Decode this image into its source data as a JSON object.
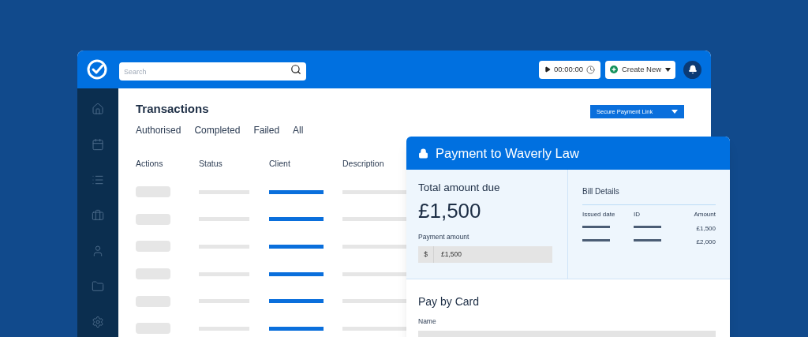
{
  "header": {
    "search": {
      "placeholder": "Search"
    },
    "timer": "00:00:00",
    "create_button": "Create New"
  },
  "transactions": {
    "title": "Transactions",
    "secure_link_button": "Secure Payment Link",
    "tabs": [
      "Authorised",
      "Completed",
      "Failed",
      "All"
    ],
    "columns": [
      "Actions",
      "Status",
      "Client",
      "Description"
    ],
    "rows": [
      {
        "kind": "placeholder"
      },
      {
        "kind": "placeholder"
      },
      {
        "kind": "placeholder"
      },
      {
        "kind": "placeholder"
      },
      {
        "kind": "placeholder"
      },
      {
        "kind": "placeholder"
      }
    ]
  },
  "payment_card": {
    "title": "Payment to Waverly Law",
    "total_label": "Total amount due",
    "total": "£1,500",
    "payment_amount_label": "Payment amount",
    "currency": "$",
    "payment_amount": "£1,500",
    "bill_details": {
      "title": "Bill Details",
      "columns": [
        "Issued date",
        "ID",
        "Amount"
      ],
      "rows": [
        {
          "amount": "£1,500"
        },
        {
          "amount": "£2,000"
        }
      ]
    },
    "pay_by_card": {
      "title": "Pay by Card",
      "name_label": "Name"
    }
  }
}
